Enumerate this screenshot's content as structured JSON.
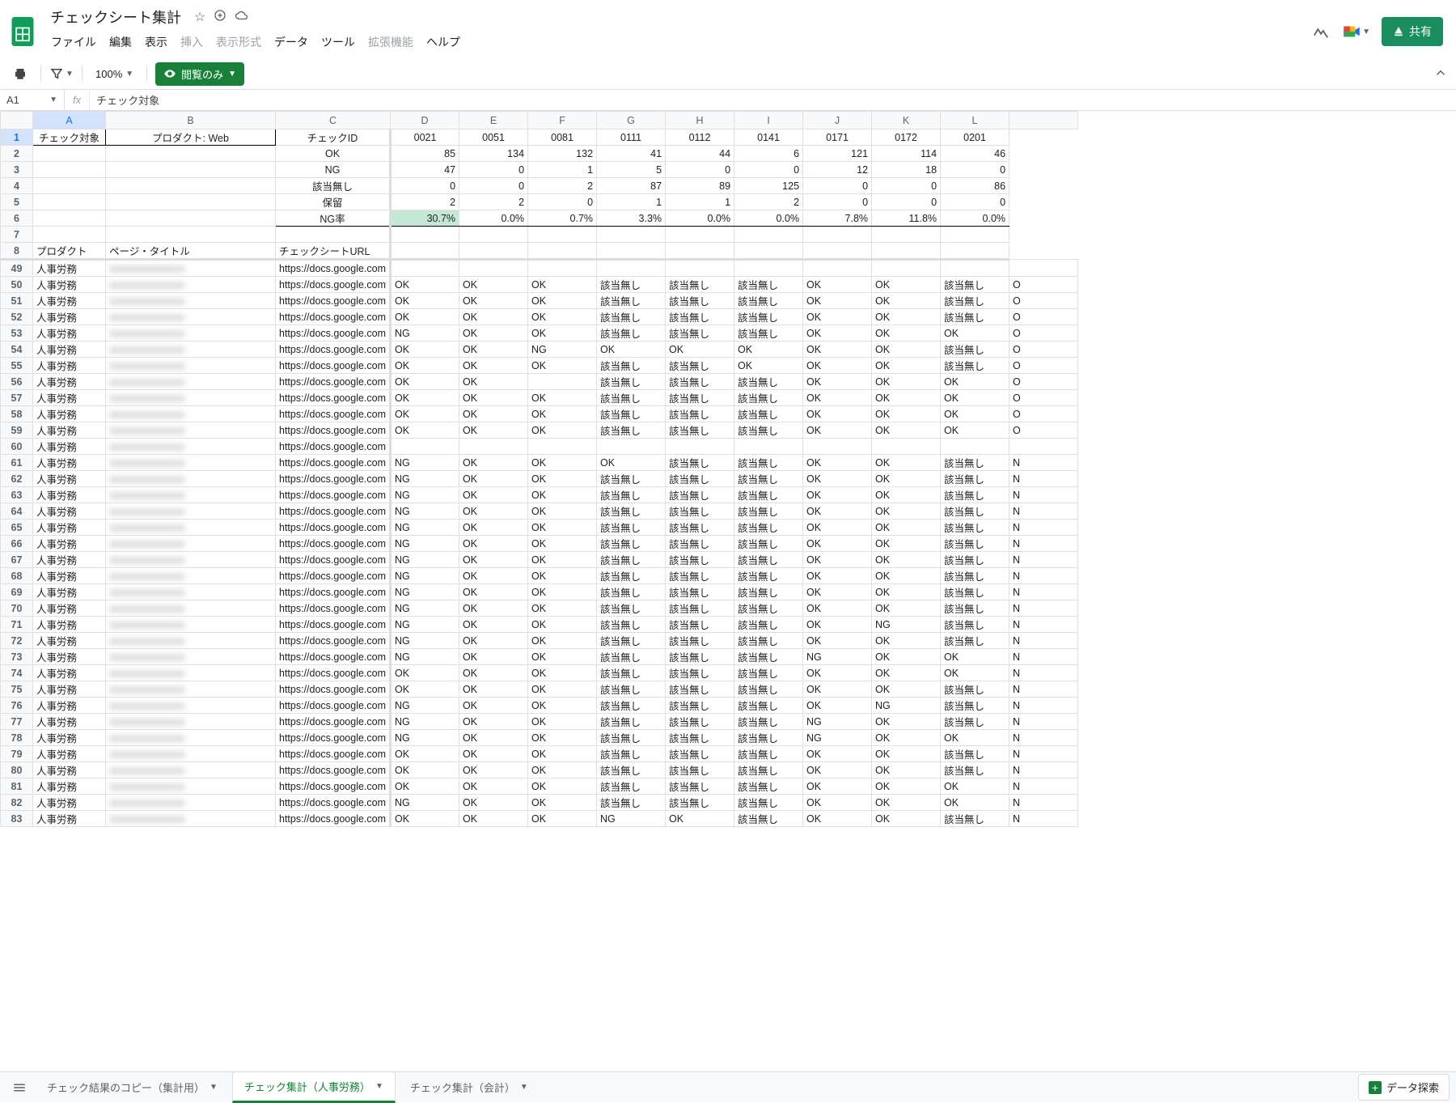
{
  "doc": {
    "title": "チェックシート集計",
    "star": "☆"
  },
  "menus": [
    "ファイル",
    "編集",
    "表示",
    "挿入",
    "表示形式",
    "データ",
    "ツール",
    "拡張機能",
    "ヘルプ"
  ],
  "menus_disabled": [
    3,
    4,
    7
  ],
  "share_label": "共有",
  "toolbar": {
    "zoom": "100%",
    "view_only": "閲覧のみ"
  },
  "formula": {
    "name_box": "A1",
    "fx": "fx",
    "content": "チェック対象"
  },
  "columns": [
    "A",
    "B",
    "C",
    "D",
    "E",
    "F",
    "G",
    "H",
    "I",
    "J",
    "K",
    "L"
  ],
  "col_classes": [
    "col-A",
    "col-B",
    "col-C",
    "col-D",
    "col-E",
    "col-F",
    "col-G",
    "col-H",
    "col-I",
    "col-J",
    "col-K",
    "col-L"
  ],
  "row1": {
    "A": "チェック対象",
    "B": "プロダクト: Web",
    "C": "チェックID",
    "ids": [
      "0021",
      "0051",
      "0081",
      "0111",
      "0112",
      "0141",
      "0171",
      "0172",
      "0201"
    ]
  },
  "stats": [
    {
      "label": "OK",
      "vals": [
        85,
        134,
        132,
        41,
        44,
        6,
        121,
        114,
        46
      ]
    },
    {
      "label": "NG",
      "vals": [
        47,
        0,
        1,
        5,
        0,
        0,
        12,
        18,
        0
      ]
    },
    {
      "label": "該当無し",
      "vals": [
        0,
        0,
        2,
        87,
        89,
        125,
        0,
        0,
        86
      ]
    },
    {
      "label": "保留",
      "vals": [
        2,
        2,
        0,
        1,
        1,
        2,
        0,
        0,
        0
      ]
    },
    {
      "label": "NG率",
      "vals": [
        "30.7%",
        "0.0%",
        "0.7%",
        "3.3%",
        "0.0%",
        "0.0%",
        "7.8%",
        "11.8%",
        "0.0%"
      ]
    }
  ],
  "row8": {
    "A": "プロダクト",
    "B": "ページ・タイトル",
    "C": "チェックシートURL"
  },
  "data_rows": [
    {
      "r": 49,
      "url": "https://docs.google.com",
      "v": [
        "",
        "",
        "",
        "",
        "",
        "",
        "",
        "",
        ""
      ]
    },
    {
      "r": 50,
      "url": "https://docs.google.com",
      "v": [
        "OK",
        "OK",
        "OK",
        "該当無し",
        "該当無し",
        "該当無し",
        "OK",
        "OK",
        "該当無し"
      ],
      "m": "O"
    },
    {
      "r": 51,
      "url": "https://docs.google.com",
      "v": [
        "OK",
        "OK",
        "OK",
        "該当無し",
        "該当無し",
        "該当無し",
        "OK",
        "OK",
        "該当無し"
      ],
      "m": "O"
    },
    {
      "r": 52,
      "url": "https://docs.google.com",
      "v": [
        "OK",
        "OK",
        "OK",
        "該当無し",
        "該当無し",
        "該当無し",
        "OK",
        "OK",
        "該当無し"
      ],
      "m": "O"
    },
    {
      "r": 53,
      "url": "https://docs.google.com",
      "v": [
        "NG",
        "OK",
        "OK",
        "該当無し",
        "該当無し",
        "該当無し",
        "OK",
        "OK",
        "OK"
      ],
      "m": "O"
    },
    {
      "r": 54,
      "url": "https://docs.google.com",
      "v": [
        "OK",
        "OK",
        "NG",
        "OK",
        "OK",
        "OK",
        "OK",
        "OK",
        "該当無し"
      ],
      "m": "O"
    },
    {
      "r": 55,
      "url": "https://docs.google.com",
      "v": [
        "OK",
        "OK",
        "OK",
        "該当無し",
        "該当無し",
        "OK",
        "OK",
        "OK",
        "該当無し"
      ],
      "m": "O"
    },
    {
      "r": 56,
      "url": "https://docs.google.com",
      "v": [
        "OK",
        "OK",
        "",
        "該当無し",
        "該当無し",
        "該当無し",
        "OK",
        "OK",
        "OK"
      ],
      "m": "O"
    },
    {
      "r": 57,
      "url": "https://docs.google.com",
      "v": [
        "OK",
        "OK",
        "OK",
        "該当無し",
        "該当無し",
        "該当無し",
        "OK",
        "OK",
        "OK"
      ],
      "m": "O"
    },
    {
      "r": 58,
      "url": "https://docs.google.com",
      "v": [
        "OK",
        "OK",
        "OK",
        "該当無し",
        "該当無し",
        "該当無し",
        "OK",
        "OK",
        "OK"
      ],
      "m": "O"
    },
    {
      "r": 59,
      "url": "https://docs.google.com",
      "v": [
        "OK",
        "OK",
        "OK",
        "該当無し",
        "該当無し",
        "該当無し",
        "OK",
        "OK",
        "OK"
      ],
      "m": "O"
    },
    {
      "r": 60,
      "url": "https://docs.google.com",
      "v": [
        "",
        "",
        "",
        "",
        "",
        "",
        "",
        "",
        ""
      ]
    },
    {
      "r": 61,
      "url": "https://docs.google.com",
      "v": [
        "NG",
        "OK",
        "OK",
        "OK",
        "該当無し",
        "該当無し",
        "OK",
        "OK",
        "該当無し"
      ],
      "m": "N"
    },
    {
      "r": 62,
      "url": "https://docs.google.com",
      "v": [
        "NG",
        "OK",
        "OK",
        "該当無し",
        "該当無し",
        "該当無し",
        "OK",
        "OK",
        "該当無し"
      ],
      "m": "N"
    },
    {
      "r": 63,
      "url": "https://docs.google.com",
      "v": [
        "NG",
        "OK",
        "OK",
        "該当無し",
        "該当無し",
        "該当無し",
        "OK",
        "OK",
        "該当無し"
      ],
      "m": "N"
    },
    {
      "r": 64,
      "url": "https://docs.google.com",
      "v": [
        "NG",
        "OK",
        "OK",
        "該当無し",
        "該当無し",
        "該当無し",
        "OK",
        "OK",
        "該当無し"
      ],
      "m": "N"
    },
    {
      "r": 65,
      "url": "https://docs.google.com",
      "v": [
        "NG",
        "OK",
        "OK",
        "該当無し",
        "該当無し",
        "該当無し",
        "OK",
        "OK",
        "該当無し"
      ],
      "m": "N"
    },
    {
      "r": 66,
      "url": "https://docs.google.com",
      "v": [
        "NG",
        "OK",
        "OK",
        "該当無し",
        "該当無し",
        "該当無し",
        "OK",
        "OK",
        "該当無し"
      ],
      "m": "N"
    },
    {
      "r": 67,
      "url": "https://docs.google.com",
      "v": [
        "NG",
        "OK",
        "OK",
        "該当無し",
        "該当無し",
        "該当無し",
        "OK",
        "OK",
        "該当無し"
      ],
      "m": "N"
    },
    {
      "r": 68,
      "url": "https://docs.google.com",
      "v": [
        "NG",
        "OK",
        "OK",
        "該当無し",
        "該当無し",
        "該当無し",
        "OK",
        "OK",
        "該当無し"
      ],
      "m": "N"
    },
    {
      "r": 69,
      "url": "https://docs.google.com",
      "v": [
        "NG",
        "OK",
        "OK",
        "該当無し",
        "該当無し",
        "該当無し",
        "OK",
        "OK",
        "該当無し"
      ],
      "m": "N"
    },
    {
      "r": 70,
      "url": "https://docs.google.com",
      "v": [
        "NG",
        "OK",
        "OK",
        "該当無し",
        "該当無し",
        "該当無し",
        "OK",
        "OK",
        "該当無し"
      ],
      "m": "N"
    },
    {
      "r": 71,
      "url": "https://docs.google.com",
      "v": [
        "NG",
        "OK",
        "OK",
        "該当無し",
        "該当無し",
        "該当無し",
        "OK",
        "NG",
        "該当無し"
      ],
      "m": "N"
    },
    {
      "r": 72,
      "url": "https://docs.google.com",
      "v": [
        "NG",
        "OK",
        "OK",
        "該当無し",
        "該当無し",
        "該当無し",
        "OK",
        "OK",
        "該当無し"
      ],
      "m": "N"
    },
    {
      "r": 73,
      "url": "https://docs.google.com",
      "v": [
        "NG",
        "OK",
        "OK",
        "該当無し",
        "該当無し",
        "該当無し",
        "NG",
        "OK",
        "OK"
      ],
      "m": "N"
    },
    {
      "r": 74,
      "url": "https://docs.google.com",
      "v": [
        "OK",
        "OK",
        "OK",
        "該当無し",
        "該当無し",
        "該当無し",
        "OK",
        "OK",
        "OK"
      ],
      "m": "N"
    },
    {
      "r": 75,
      "url": "https://docs.google.com",
      "v": [
        "OK",
        "OK",
        "OK",
        "該当無し",
        "該当無し",
        "該当無し",
        "OK",
        "OK",
        "該当無し"
      ],
      "m": "N"
    },
    {
      "r": 76,
      "url": "https://docs.google.com",
      "v": [
        "NG",
        "OK",
        "OK",
        "該当無し",
        "該当無し",
        "該当無し",
        "OK",
        "NG",
        "該当無し"
      ],
      "m": "N"
    },
    {
      "r": 77,
      "url": "https://docs.google.com",
      "v": [
        "NG",
        "OK",
        "OK",
        "該当無し",
        "該当無し",
        "該当無し",
        "NG",
        "OK",
        "該当無し"
      ],
      "m": "N"
    },
    {
      "r": 78,
      "url": "https://docs.google.com",
      "v": [
        "NG",
        "OK",
        "OK",
        "該当無し",
        "該当無し",
        "該当無し",
        "NG",
        "OK",
        "OK"
      ],
      "m": "N"
    },
    {
      "r": 79,
      "url": "https://docs.google.com",
      "v": [
        "OK",
        "OK",
        "OK",
        "該当無し",
        "該当無し",
        "該当無し",
        "OK",
        "OK",
        "該当無し"
      ],
      "m": "N"
    },
    {
      "r": 80,
      "url": "https://docs.google.com",
      "v": [
        "OK",
        "OK",
        "OK",
        "該当無し",
        "該当無し",
        "該当無し",
        "OK",
        "OK",
        "該当無し"
      ],
      "m": "N"
    },
    {
      "r": 81,
      "url": "https://docs.google.com",
      "v": [
        "OK",
        "OK",
        "OK",
        "該当無し",
        "該当無し",
        "該当無し",
        "OK",
        "OK",
        "OK"
      ],
      "m": "N"
    },
    {
      "r": 82,
      "url": "https://docs.google.com",
      "v": [
        "NG",
        "OK",
        "OK",
        "該当無し",
        "該当無し",
        "該当無し",
        "OK",
        "OK",
        "OK"
      ],
      "m": "N"
    },
    {
      "r": 83,
      "url": "https://docs.google.com",
      "v": [
        "OK",
        "OK",
        "OK",
        "NG",
        "OK",
        "該当無し",
        "OK",
        "OK",
        "該当無し"
      ],
      "m": "N"
    }
  ],
  "product_label": "人事労務",
  "tabs": [
    {
      "label": "チェック結果のコピー（集計用）",
      "active": false
    },
    {
      "label": "チェック集計（人事労務）",
      "active": true
    },
    {
      "label": "チェック集計（会計）",
      "active": false
    }
  ],
  "explore_label": "データ探索"
}
